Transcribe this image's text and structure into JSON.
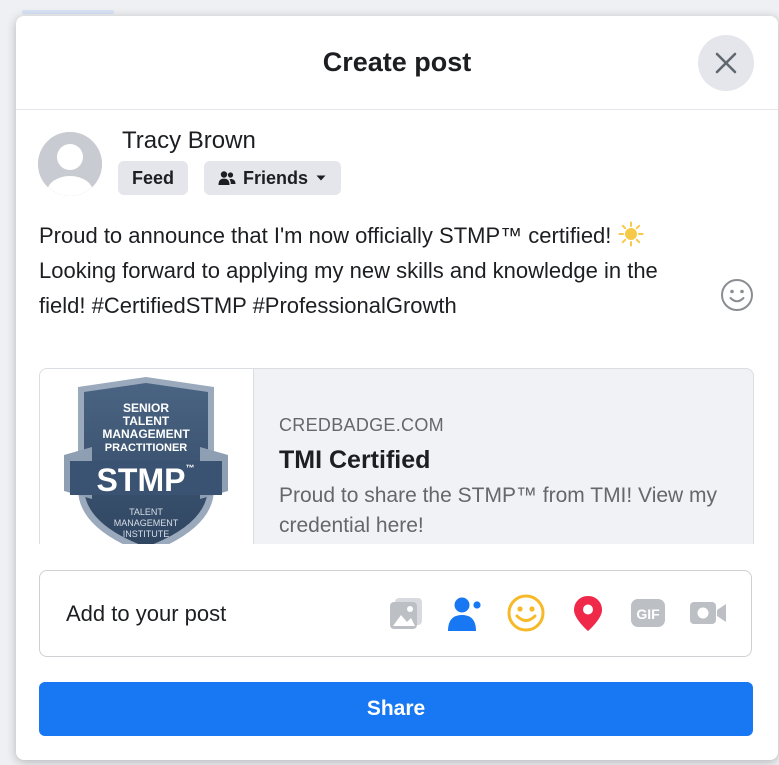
{
  "dialog": {
    "title": "Create post",
    "close_icon": "close-icon"
  },
  "author": {
    "name": "Tracy Brown",
    "avatar_icon": "default-avatar-icon",
    "feed_label": "Feed",
    "audience_label": "Friends",
    "audience_icon": "friends-icon"
  },
  "post": {
    "line1": "Proud to announce that I'm now officially STMP™ certified!",
    "line1_emoji": "sun-emoji",
    "line2": "Looking forward to applying my new skills and knowledge in the",
    "line3": "field! #CertifiedSTMP #ProfessionalGrowth",
    "emoji_button_icon": "smiley-icon"
  },
  "link_preview": {
    "domain": "CREDBADGE.COM",
    "title": "TMI Certified",
    "description": "Proud to share the STMP™ from TMI! View my credential here!",
    "badge": {
      "line1": "SENIOR",
      "line2": "TALENT",
      "line3": "MANAGEMENT",
      "line4": "PRACTITIONER",
      "acronym": "STMP",
      "tm": "™",
      "footer1": "TALENT",
      "footer2": "MANAGEMENT",
      "footer3": "INSTITUTE"
    }
  },
  "add_to_post": {
    "label": "Add to your post",
    "icons": [
      "photo-icon",
      "tag-people-icon",
      "feeling-icon",
      "location-icon",
      "gif-icon",
      "live-video-icon"
    ],
    "gif_text": "GIF"
  },
  "actions": {
    "share_label": "Share"
  },
  "colors": {
    "accent": "#1877f2",
    "location": "#f02849",
    "feeling": "#f7b928",
    "disabled_icon": "#bcc0c4"
  }
}
